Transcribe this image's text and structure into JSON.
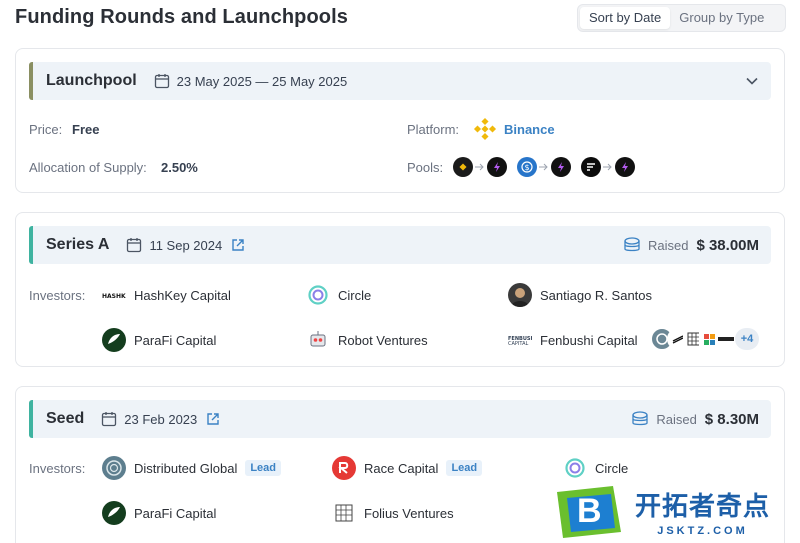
{
  "page": {
    "title": "Funding Rounds and Launchpools"
  },
  "sort": {
    "options": [
      "Sort by Date",
      "Group by Type"
    ],
    "active": "Sort by Date"
  },
  "launchpool": {
    "name": "Launchpool",
    "date": "23 May 2025 — 25 May 2025",
    "price_label": "Price:",
    "price_value": "Free",
    "allocation_label": "Allocation of Supply:",
    "allocation_value": "2.50%",
    "platform_label": "Platform:",
    "platform_value": "Binance",
    "pools_label": "Pools:",
    "accent": "#8a8f62"
  },
  "series_a": {
    "name": "Series A",
    "date": "11 Sep 2024",
    "raised_label": "Raised",
    "raised_amount": "$ 38.00M",
    "investors_label": "Investors:",
    "investors": [
      {
        "name": "HashKey Capital",
        "icon": "hashkey-logo"
      },
      {
        "name": "Circle",
        "icon": "circle-logo"
      },
      {
        "name": "Santiago R. Santos",
        "icon": "person-avatar"
      },
      {
        "name": "ParaFi Capital",
        "icon": "parafi-logo"
      },
      {
        "name": "Robot Ventures",
        "icon": "robot-logo"
      },
      {
        "name": "Fenbushi Capital",
        "icon": "fenbushi-logo"
      }
    ],
    "more_count": "+4",
    "accent": "#3fb3a0"
  },
  "seed": {
    "name": "Seed",
    "date": "23 Feb 2023",
    "raised_label": "Raised",
    "raised_amount": "$ 8.30M",
    "investors_label": "Investors:",
    "lead_label": "Lead",
    "investors": [
      {
        "name": "Distributed Global",
        "icon": "distributed-global-logo",
        "lead": true
      },
      {
        "name": "Race Capital",
        "icon": "race-capital-logo",
        "lead": true
      },
      {
        "name": "Circle",
        "icon": "circle-logo",
        "lead": false
      },
      {
        "name": "ParaFi Capital",
        "icon": "parafi-logo",
        "lead": false
      },
      {
        "name": "Folius Ventures",
        "icon": "folius-logo",
        "lead": false
      }
    ],
    "accent": "#3fb3a0"
  },
  "watermark": {
    "cn": "开拓者奇点",
    "en": "JSKTZ.COM",
    "letter": "B"
  }
}
